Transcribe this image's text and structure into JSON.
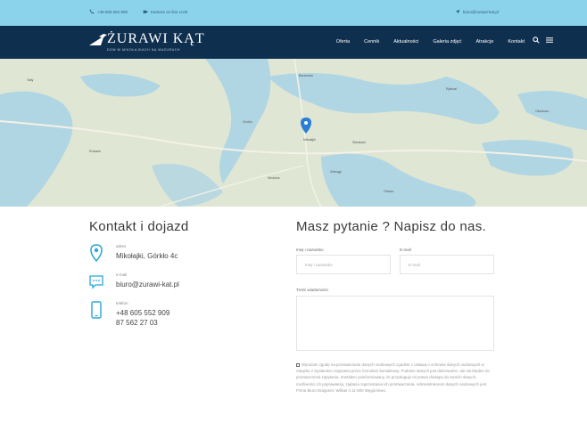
{
  "topbar": {
    "phone": "+48 605 552 909",
    "camera": "Kamera on-line LIVE",
    "email": "biuro@zurawi-kat.pl"
  },
  "header": {
    "logo_title": "ŻURAWI KĄT",
    "logo_subtitle": "DOM W MIKOŁAJKACH NA MAZURACH",
    "nav": [
      "Oferta",
      "Cennik",
      "Aktualności",
      "Galeria zdjęć",
      "Atrakcje",
      "Kontakt"
    ]
  },
  "map": {
    "labels": [
      "Baranowo",
      "Mikołajki",
      "Górkło",
      "Woźnice",
      "Sterławki",
      "Orłowo",
      "Tałty",
      "Ruciane",
      "Rybical",
      "Okartowo",
      "Zełwągi"
    ]
  },
  "contact": {
    "title": "Kontakt i dojazd",
    "address_label": "adres",
    "address": "Mikołajki, Górkło 4c",
    "email_label": "e-mail",
    "email": "biuro@zurawi-kat.pl",
    "phone_label": "telefon",
    "phone1": "+48 605 552 909",
    "phone2": "87 562 27 03"
  },
  "form": {
    "title": "Masz pytanie ? Napisz do nas.",
    "name_label": "Imię i nazwisko",
    "name_placeholder": "Imię i nazwisko",
    "email_label": "E-mail",
    "email_placeholder": "E-mail",
    "message_label": "Treść wiadomości",
    "consent": "Wyrażam zgodę na przetwarzanie danych osobowych zgodnie z ustawą o ochronie danych osobowych w związku z wysłaniem zapytania przez formularz kontaktowy. Podanie danych jest dobrowolne, ale niezbędne do przetworzenia zapytania. Zostałem poinformowany, że przysługuje mi prawo dostępu do swoich danych, możliwości ich poprawiania, żądania zaprzestania ich przetwarzania. Administratorem danych osobowych jest Firma Biuro Dragonet. Wilkaś 4 11-600 Węgorzewo."
  },
  "colors": {
    "topbar": "#8ad3ea",
    "navbar": "#0f2f4e",
    "accent": "#29a7d6",
    "map_land": "#dfe6d4",
    "map_water": "#a8d2e6"
  }
}
